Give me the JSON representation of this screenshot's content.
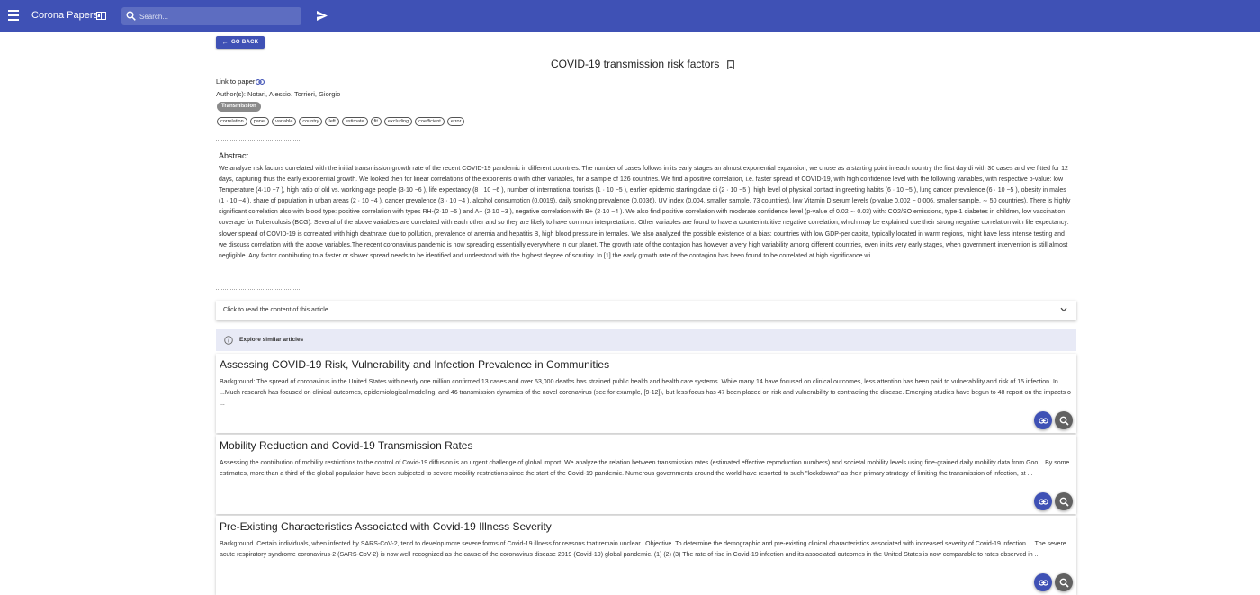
{
  "appbar": {
    "title": "Corona Papers",
    "search_placeholder": "Search...",
    "icons": [
      "menu-icon",
      "book-icon",
      "search-icon",
      "send-icon"
    ],
    "color": "#3f51b5"
  },
  "actions": {
    "go_back": "GO BACK"
  },
  "paper": {
    "title": "COVID-19 transmission risk factors",
    "link_label": "Link to paper",
    "authors": "Author(s): Notari, Alessio. Torrieri, Giorgio",
    "category": "Transmission",
    "keywords": [
      "correlation",
      "panel",
      "variable",
      "country",
      "left",
      "estimate",
      "fit",
      "excluding",
      "coefficient",
      "error"
    ],
    "abstract_heading": "Abstract",
    "abstract": "We analyze risk factors correlated with the initial transmission growth rate of the recent COVID-19 pandemic in different countries. The number of cases follows in its early stages an almost exponential expansion; we chose as a starting point in each country the first day di with 30 cases and we fitted for 12 days, capturing thus the early exponential growth. We looked then for linear correlations of the exponents α with other variables, for a sample of 126 countries. We find a positive correlation, i.e. faster spread of COVID-19, with high confidence level with the following variables, with respective p-value: low Temperature (4·10 −7 ), high ratio of old vs. working-age people (3·10 −6 ), life expectancy (8 · 10 −6 ), number of international tourists (1 · 10 −5 ), earlier epidemic starting date di (2 · 10 −5 ), high level of physical contact in greeting habits (6 · 10 −5 ), lung cancer prevalence (6 · 10 −5 ), obesity in males (1 · 10 −4 ), share of population in urban areas (2 · 10 −4 ), cancer prevalence (3 · 10 −4 ), alcohol consumption (0.0019), daily smoking prevalence (0.0036), UV index (0.004, smaller sample, 73 countries), low Vitamin D serum levels (p-value 0.002 − 0.006, smaller sample, ∼ 50 countries). There is highly significant correlation also with blood type: positive correlation with types RH-(2·10 −5 ) and A+ (2·10 −3 ), negative correlation with B+ (2·10 −4 ). We also find positive correlation with moderate confidence level (p-value of 0.02 ∼ 0.03) with: CO2/SO emissions, type-1 diabetes in children, low vaccination coverage for Tuberculosis (BCG). Several of the above variables are correlated with each other and so they are likely to have common interpretations. Other variables are found to have a counterintuitive negative correlation, which may be explained due their strong negative correlation with life expectancy: slower spread of COVID-19 is correlated with high deathrate due to pollution, prevalence of anemia and hepatitis B, high blood pressure in females. We also analyzed the possible existence of a bias: countries with low GDP-per capita, typically located in warm regions, might have less intense testing and we discuss correlation with the above variables.The recent coronavirus pandemic is now spreading essentially everywhere in our planet. The growth rate of the contagion has however a very high variability among different countries, even in its very early stages, when government intervention is still almost negligible. Any factor contributing to a faster or slower spread needs to be identified and understood with the highest degree of scrutiny. In [1] the early growth rate of the contagion has been found to be correlated at high significance wi ...",
    "expand_label": "Click to read the content of this article"
  },
  "similar": {
    "heading": "Explore similar articles",
    "articles": [
      {
        "title": "Assessing COVID-19 Risk, Vulnerability and Infection Prevalence in Communities",
        "text": "Background: The spread of coronavirus in the United States with nearly one million confirmed 13 cases and over 53,000 deaths has strained public health and health care systems. While many 14 have focused on clinical outcomes, less attention has been paid to vulnerability and risk of 15 infection. In ...Much research has focused on clinical outcomes, epidemiological modeling, and 46 transmission dynamics of the novel coronavirus (see for example, [9-12]), but less focus has 47 been placed on risk and vulnerability to contracting the disease. Emerging studies have begun to 48 report on the impacts o ..."
      },
      {
        "title": "Mobility Reduction and Covid-19 Transmission Rates",
        "text": "Assessing the contribution of mobility restrictions to the control of Covid-19 diffusion is an urgent challenge of global import. We analyze the relation between transmission rates (estimated effective reproduction numbers) and societal mobility levels using fine-grained daily mobility data from Goo ...By some estimates, more than a third of the global population have been subjected to severe mobility restrictions since the start of the Covid-19 pandemic. Numerous governments around the world have resorted to such \"lockdowns\" as their primary strategy of limiting the transmission of infection, at ..."
      },
      {
        "title": "Pre-Existing Characteristics Associated with Covid-19 Illness Severity",
        "text": "Background. Certain individuals, when infected by SARS-CoV-2, tend to develop more severe forms of Covid-19 illness for reasons that remain unclear.. Objective. To determine the demographic and pre-existing clinical characteristics associated with increased severity of Covid-19 infection. ...The severe acute respiratory syndrome coronavirus-2 (SARS-CoV-2) is now well recognized as the cause of the coronavirus disease 2019 (Covid-19) global pandemic. (1) (2) (3) The rate of rise in Covid-19 infection and its associated outcomes in the United States is now comparable to rates observed in ..."
      }
    ]
  }
}
